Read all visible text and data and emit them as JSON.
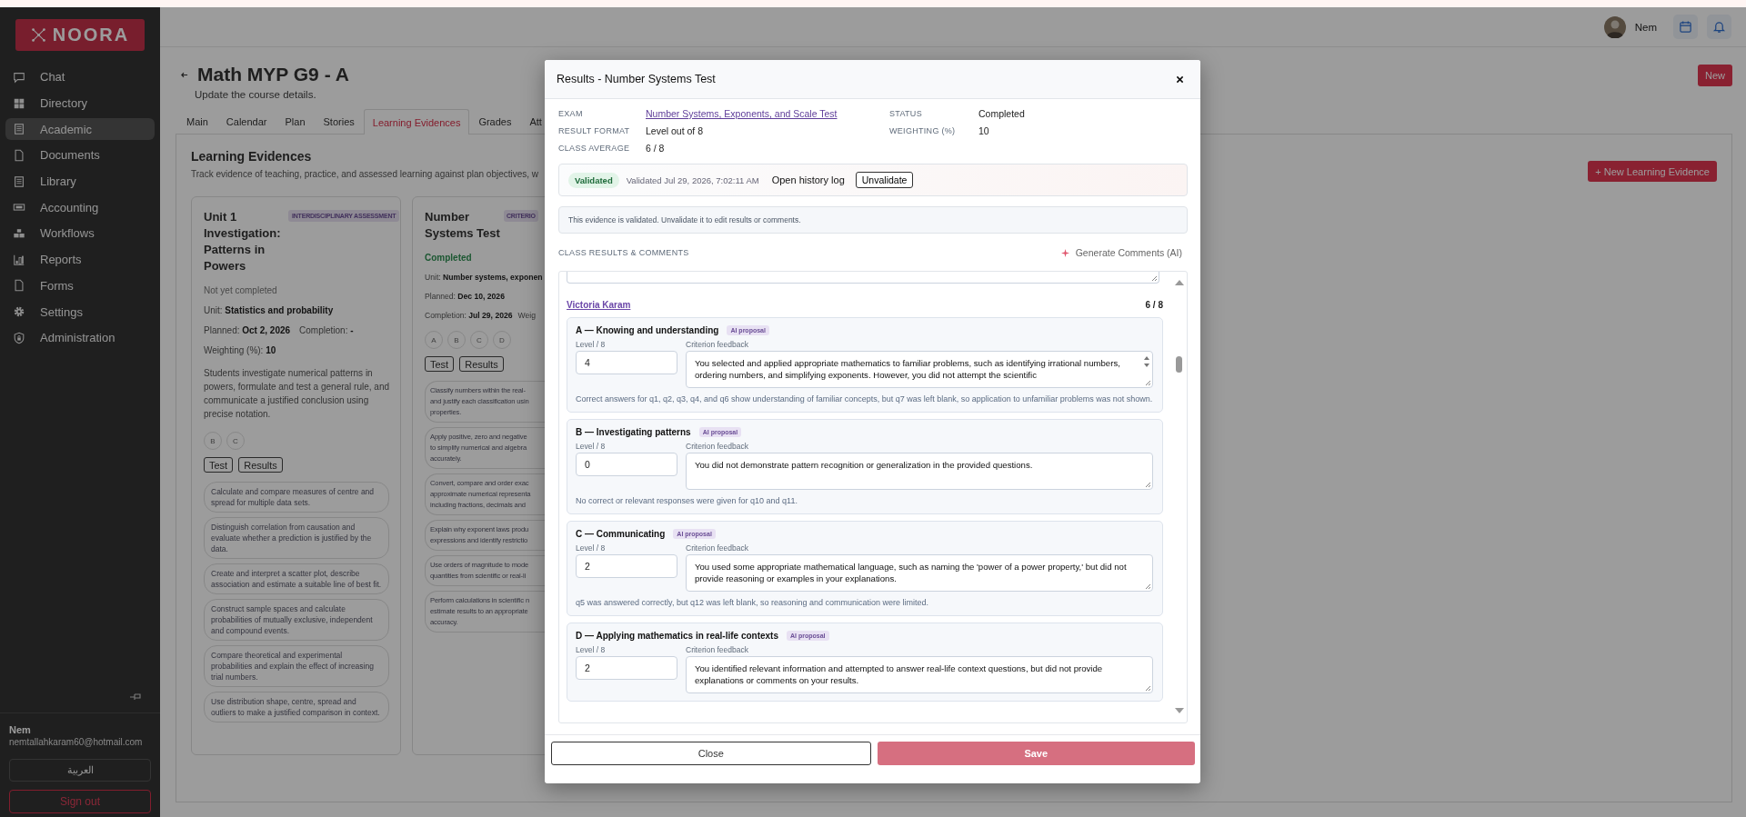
{
  "top_bar": {
    "user_name": "Nem"
  },
  "sidebar": {
    "logo": "NOORA",
    "items": [
      {
        "label": "Chat",
        "selected": false
      },
      {
        "label": "Directory",
        "selected": false
      },
      {
        "label": "Academic",
        "selected": true
      },
      {
        "label": "Documents",
        "selected": false
      },
      {
        "label": "Library",
        "selected": false
      },
      {
        "label": "Accounting",
        "selected": false
      },
      {
        "label": "Workflows",
        "selected": false
      },
      {
        "label": "Reports",
        "selected": false
      },
      {
        "label": "Forms",
        "selected": false
      },
      {
        "label": "Settings",
        "selected": false
      },
      {
        "label": "Administration",
        "selected": false
      }
    ],
    "user": {
      "name": "Nem",
      "email": "nemtallahkaram60@hotmail.com"
    },
    "language_button": "العربية",
    "sign_out_button": "Sign out"
  },
  "page": {
    "title": "Math MYP G9 - A",
    "subtitle": "Update the course details.",
    "new_button": "New",
    "tabs": [
      {
        "label": "Main",
        "selected": false
      },
      {
        "label": "Calendar",
        "selected": false
      },
      {
        "label": "Plan",
        "selected": false
      },
      {
        "label": "Stories",
        "selected": false
      },
      {
        "label": "Learning Evidences",
        "selected": true
      },
      {
        "label": "Grades",
        "selected": false
      },
      {
        "label": "Att",
        "selected": false
      }
    ],
    "section": {
      "title": "Learning Evidences",
      "description": "Track evidence of teaching, practice, and assessed learning against plan objectives, w",
      "new_button": "+ New Learning Evidence",
      "cards": [
        {
          "title": "Unit 1 Investigation: Patterns in Powers",
          "badge": "INTERDISCIPLINARY ASSESSMENT",
          "status": "Not yet completed",
          "completed": false,
          "meta": [
            [
              "Unit: **Statistics and probability**"
            ],
            [
              "Planned: **Oct 2, 2026**",
              "Completion: **-**"
            ],
            [
              "Weighting (%): **10**"
            ]
          ],
          "description": "Students investigate numerical patterns in powers, formulate and test a general rule, and communicate a justified conclusion using precise notation.",
          "criteria": [
            "B",
            "C"
          ],
          "buttons": [
            "Test",
            "Results"
          ],
          "objectives": [
            "Calculate and compare measures of centre and spread for multiple data sets.",
            "Distinguish correlation from causation and evaluate whether a prediction is justified by the data.",
            "Create and interpret a scatter plot, describe association and estimate a suitable line of best fit.",
            "Construct sample spaces and calculate probabilities of mutually exclusive, independent and compound events.",
            "Compare theoretical and experimental probabilities and explain the effect of increasing trial numbers.",
            "Use distribution shape, centre, spread and outliers to make a justified comparison in context."
          ]
        },
        {
          "title": "Number Systems Test",
          "badge": "CRITERIO",
          "status": "Completed",
          "completed": true,
          "meta": [
            [
              "Unit: **Number systems, exponen**"
            ],
            [
              "Planned: **Dec 10, 2026**"
            ],
            [
              "Completion: **Jul 29, 2026**",
              "Weig"
            ]
          ],
          "criteria": [
            "A",
            "B",
            "C",
            "D"
          ],
          "buttons": [
            "Test",
            "Results"
          ],
          "objectives": [
            "Classify numbers within the real-\nand justify each classification usin\nproperties.",
            "Apply positive, zero and negative\nto simplify numerical and algebra\naccurately.",
            "Convert, compare and order exac\napproximate numerical representa\nincluding fractions, decimals and",
            "Explain why exponent laws produ\nexpressions and identify restrictio",
            "Use orders of magnitude to mode\nquantities from scientific or real-li",
            "Perform calculations in scientific n\nestimate results to an appropriate\naccuracy."
          ]
        }
      ]
    }
  },
  "modal": {
    "title": "Results - Number Systems Test",
    "info": [
      {
        "label": "EXAM",
        "value": "Number Systems, Exponents, and Scale Test",
        "kind": "link"
      },
      {
        "label": "STATUS",
        "value": "Completed",
        "kind": "text"
      },
      {
        "label": "RESULT FORMAT",
        "value": "Level out of 8",
        "kind": "text"
      },
      {
        "label": "WEIGHTING (%)",
        "value": "10",
        "kind": "text"
      },
      {
        "label": "CLASS AVERAGE",
        "value": "6 / 8",
        "kind": "text"
      }
    ],
    "validation": {
      "validated": true,
      "badge": "Validated",
      "timestamp": "Validated Jul 29, 2026, 7:02:11 AM",
      "history_link": "Open history log",
      "button": "Unvalidate"
    },
    "notice": "This evidence is validated. Unvalidate it to edit results or comments.",
    "section_label": "CLASS RESULTS & COMMENTS",
    "generate_button": "Generate Comments (AI)",
    "student": {
      "name": "Victoria Karam",
      "score": "6 / 8",
      "criteria": [
        {
          "title": "A — Knowing and understanding",
          "tag": "AI proposal",
          "level_label": "Level / 8",
          "level_value": "4",
          "feedback_label": "Criterion feedback",
          "feedback": "You selected and applied appropriate mathematics to familiar problems, such as identifying irrational numbers, ordering numbers, and simplifying exponents. However, you did not attempt the scientific",
          "scrollable": true,
          "note": "Correct answers for q1, q2, q3, q4, and q6 show understanding of familiar concepts, but q7 was left blank, so application to unfamiliar problems was not shown."
        },
        {
          "title": "B — Investigating patterns",
          "tag": "AI proposal",
          "level_label": "Level / 8",
          "level_value": "0",
          "feedback_label": "Criterion feedback",
          "feedback": "You did not demonstrate pattern recognition or generalization in the provided questions.",
          "scrollable": false,
          "note": "No correct or relevant responses were given for q10 and q11."
        },
        {
          "title": "C — Communicating",
          "tag": "AI proposal",
          "level_label": "Level / 8",
          "level_value": "2",
          "feedback_label": "Criterion feedback",
          "feedback": "You used some appropriate mathematical language, such as naming the 'power of a power property,' but did not provide reasoning or examples in your explanations.",
          "scrollable": false,
          "note": "q5 was answered correctly, but q12 was left blank, so reasoning and communication were limited."
        },
        {
          "title": "D — Applying mathematics in real-life contexts",
          "tag": "AI proposal",
          "level_label": "Level / 8",
          "level_value": "2",
          "feedback_label": "Criterion feedback",
          "feedback": "You identified relevant information and attempted to answer real-life context questions, but did not provide explanations or comments on your results.",
          "scrollable": false
        }
      ]
    },
    "buttons": [
      {
        "label": "Close",
        "kind": "secondary",
        "disabled": false
      },
      {
        "label": "Save",
        "kind": "primary",
        "disabled": true
      }
    ]
  }
}
